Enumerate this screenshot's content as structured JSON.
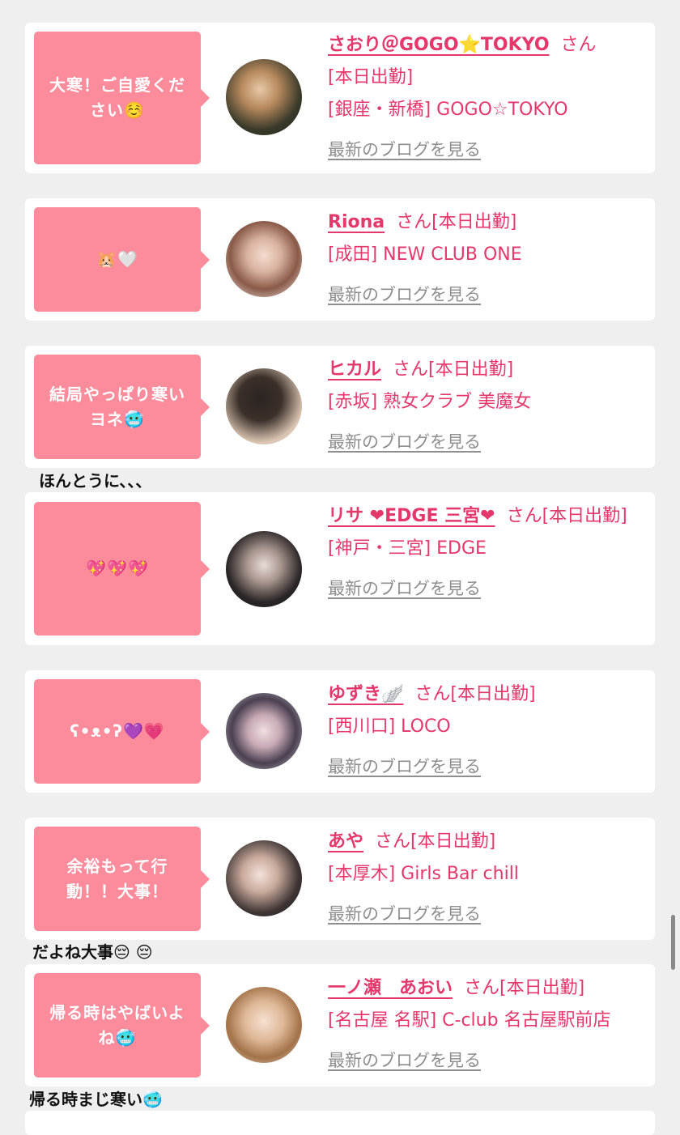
{
  "honorific": "さん",
  "blog_link": "最新のブログを見る",
  "posts": [
    {
      "bubble": "大寒！ご自愛ください",
      "bubble_emoji": "☺️",
      "name": "さおり＠GOGO⭐️TOKYO",
      "suffix": "さん",
      "status": "[本日出勤]",
      "location": "[銀座・新橋] GOGO☆TOKYO",
      "blog": "最新のブログを見る"
    },
    {
      "bubble": "",
      "bubble_emoji": "🐹🤍",
      "name": "Riona",
      "suffix": "さん[本日出勤]",
      "status": "",
      "location": "[成田] NEW CLUB ONE",
      "blog": "最新のブログを見る"
    },
    {
      "bubble": "結局やっぱり寒いヨネ",
      "bubble_emoji": "🥶",
      "name": "ヒカル",
      "suffix": "さん[本日出勤]",
      "status": "",
      "location": "[赤坂] 熟女クラブ 美魔女",
      "blog": "最新のブログを見る"
    },
    {
      "bubble": "",
      "bubble_emoji": "💖💖💖",
      "name": "リサ ❤EDGE 三宮❤",
      "suffix": "さん[本日出勤]",
      "status": "",
      "location": "[神戸・三宮] EDGE",
      "blog": "最新のブログを見る"
    },
    {
      "bubble": "ʕ•ᴥ•ʔ",
      "bubble_emoji": "💜💗",
      "name": "ゆずき🪽",
      "suffix": "さん[本日出勤]",
      "status": "",
      "location": "[西川口] LOCO",
      "blog": "最新のブログを見る"
    },
    {
      "bubble": "余裕もって行動！！大事！",
      "bubble_emoji": "",
      "name": "あや",
      "suffix": "さん[本日出勤]",
      "status": "",
      "location": "[本厚木] Girls Bar chill",
      "blog": "最新のブログを見る"
    },
    {
      "bubble": "帰る時はやばいよね",
      "bubble_emoji": "🥶",
      "name": "一ノ瀬　あおい",
      "suffix": "さん[本日出勤]",
      "status": "",
      "location": "[名古屋 名駅] C-club 名古屋駅前店",
      "blog": "最新のブログを見る"
    }
  ],
  "comments": [
    "ほんとうに、、、",
    "だよね大事😔 😔",
    "帰る時まじ寒い🥶"
  ],
  "colors": {
    "accent": "#e4376b",
    "bubble": "#fc8c9c",
    "background": "#efefef",
    "link_gray": "#8e8e8e"
  }
}
